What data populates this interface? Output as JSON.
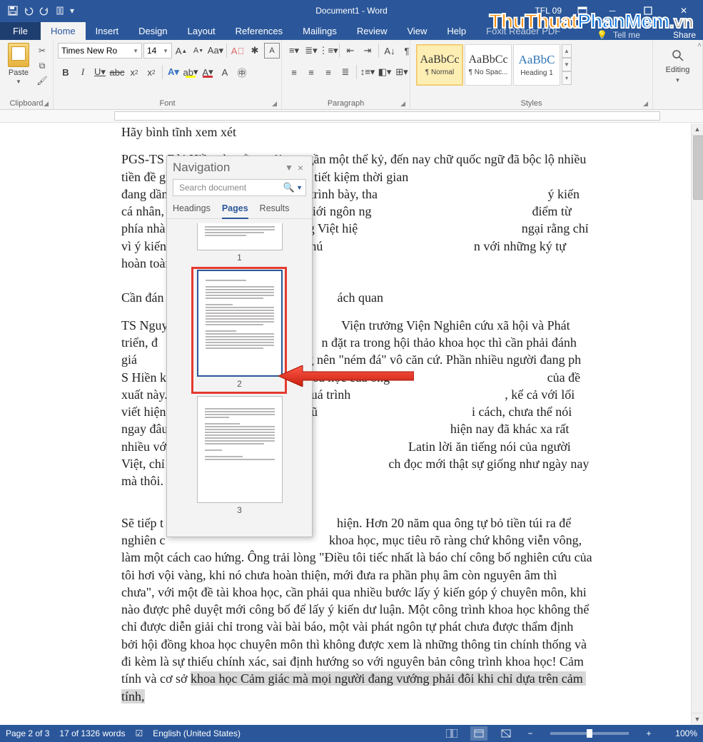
{
  "titlebar": {
    "doc_title": "Document1 - Word",
    "user": "TFL 09"
  },
  "ribbon_tabs": {
    "file": "File",
    "home": "Home",
    "insert": "Insert",
    "design": "Design",
    "layout": "Layout",
    "references": "References",
    "mailings": "Mailings",
    "review": "Review",
    "view": "View",
    "help": "Help",
    "foxit": "Foxit Reader PDF",
    "tellme": "Tell me",
    "share": "Share"
  },
  "ribbon": {
    "clipboard": {
      "label": "Clipboard",
      "paste": "Paste"
    },
    "font": {
      "label": "Font",
      "name": "Times New Ro",
      "size": "14"
    },
    "paragraph": {
      "label": "Paragraph"
    },
    "styles": {
      "label": "Styles",
      "items": [
        {
          "preview": "AaBbCc",
          "name": "¶ Normal"
        },
        {
          "preview": "AaBbCc",
          "name": "¶ No Spac..."
        },
        {
          "preview": "AaBbC",
          "name": "Heading 1"
        }
      ]
    },
    "editing": {
      "label": "Editing"
    }
  },
  "navigation": {
    "title": "Navigation",
    "search_placeholder": "Search document",
    "tabs": {
      "headings": "Headings",
      "pages": "Pages",
      "results": "Results"
    },
    "page_numbers": [
      "1",
      "2",
      "3"
    ],
    "selected_index": 1
  },
  "document": {
    "p1": "Hãy bình tĩnh xem xét",
    "p2": "PGS-TS Bùi Hiền cho rằng trải qua gần một thế kỷ, đến nay chữ quốc ngữ đã bộc lộ nhiều                                                              tiền đề giản tiện, dễ nhớ, dễ sử dụng, tiết kiệm thời gian                                                        đang dần bị thay thế, giản lược cách trình bày, tha                                                     ý kiến cá nhân, không phải quan điểm của giới ngôn ng                                                  điểm từ phía nhà nước đem áp dụng cho tiếng Việt hiệ                                                   ngại rằng chỉ vì ý kiến của ông Hiền mà nay mai chú                                               n với những ký tự hoàn toàn khác hiện nay.",
    "p3": "Cần đán                                                      ách quan",
    "p4": "TS Nguy                                                      Viện trưởng Viện Nghiên cứu xã hội và Phát triển, đ                                                   n đặt ra trong hội thảo khoa học thì cần phải đánh giá                                                   ng nên \"ném đá\" vô căn cứ. Phần nhiều người đang ph                                                    S Hiền khi chưa đọc kỹ tham luận khoa học của ông                                                 của đề xuất này. Chữ quốc ngữ đã trải qua quá trình                                                , kể cả với lối viết hiện đại, thì chính tả tiếng Việt cũ                                                i cách, chưa thể nói ngay đâu mới là lần cải cách cuố                                                  hiện nay đã khác xa rất nhiều với thời các giáo sĩ n                                              Latin lời ăn tiếng nói của người Việt, chỉ đến năm 198                                                ch đọc mới thật sự giống như ngày nay mà thôi.",
    "p5": "Sẽ tiếp t                                                      hiện. Hơn 20 năm qua ông tự bỏ tiền túi ra để nghiên c                                                   khoa học, mục tiêu rõ ràng chứ không viễn vông, làm một cách cao hứng. Ông trải lòng \"Điều tôi tiếc nhất là báo chí công bố nghiên cứu của tôi hơi vội vàng, khi nó chưa hoàn thiện, mới đưa ra phần phụ âm còn nguyên âm thì chưa\", với một đề tài khoa học, cần phải qua nhiều bước lấy ý kiến góp ý chuyên môn, khi nào được phê duyệt mới công bố để lấy ý kiến dư luận. Một công trình khoa học không thể chỉ được diễn giải chỉ trong vài bài báo, một vài phát ngôn tự phát chưa được thẩm định bởi hội đồng khoa học chuyên môn thì không được xem là những thông tin chính thống và đi kèm là sự thiếu chính xác, sai định hướng so với nguyên bản công trình khoa học! Cảm tính và cơ sở ",
    "p5_hl": "khoa học Cảm giác mà mọi người đang vướng phải đôi khi chỉ dựa trên cảm tính,"
  },
  "statusbar": {
    "page": "Page 2 of 3",
    "words": "17 of 1326 words",
    "lang": "English (United States)",
    "zoom": "100%"
  },
  "watermark": {
    "a": "ThuThuat",
    "b": "PhanMem",
    "c": ".vn"
  }
}
